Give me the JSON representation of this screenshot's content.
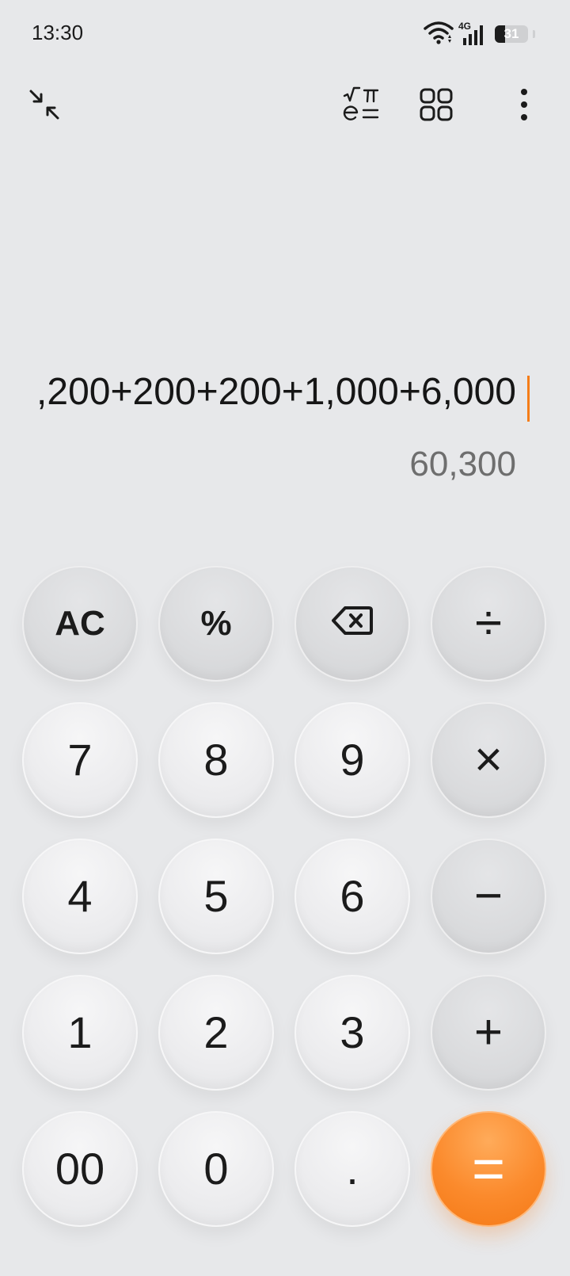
{
  "status_bar": {
    "time": "13:30",
    "network": "4G",
    "battery_level": "31",
    "battery_fraction": 0.31
  },
  "toolbar": {
    "icons": [
      "minimize-icon",
      "scientific-icon",
      "apps-grid-icon",
      "more-vert-icon"
    ]
  },
  "display": {
    "expression": ",200+200+200+1,000+6,000",
    "result": "60,300"
  },
  "keypad": {
    "rows": [
      [
        {
          "label": "AC",
          "kind": "func"
        },
        {
          "label": "%",
          "kind": "func"
        },
        {
          "label": "",
          "kind": "func",
          "icon": "backspace-icon"
        },
        {
          "label": "÷",
          "kind": "op"
        }
      ],
      [
        {
          "label": "7",
          "kind": "num"
        },
        {
          "label": "8",
          "kind": "num"
        },
        {
          "label": "9",
          "kind": "num"
        },
        {
          "label": "×",
          "kind": "op"
        }
      ],
      [
        {
          "label": "4",
          "kind": "num"
        },
        {
          "label": "5",
          "kind": "num"
        },
        {
          "label": "6",
          "kind": "num"
        },
        {
          "label": "−",
          "kind": "op"
        }
      ],
      [
        {
          "label": "1",
          "kind": "num"
        },
        {
          "label": "2",
          "kind": "num"
        },
        {
          "label": "3",
          "kind": "num"
        },
        {
          "label": "+",
          "kind": "op"
        }
      ],
      [
        {
          "label": "00",
          "kind": "num"
        },
        {
          "label": "0",
          "kind": "num"
        },
        {
          "label": ".",
          "kind": "num"
        },
        {
          "label": "=",
          "kind": "equals"
        }
      ]
    ]
  },
  "colors": {
    "background": "#e7e8ea",
    "accent": "#f57d18",
    "result_text": "#6e6e6e"
  }
}
